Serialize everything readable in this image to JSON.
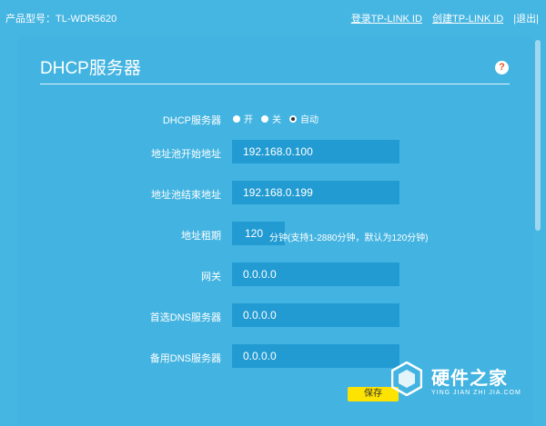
{
  "header": {
    "model": "产品型号：TL-WDR5620",
    "links": [
      "登录TP-LINK ID",
      "创建TP-LINK ID",
      "|退出|"
    ]
  },
  "page": {
    "title": "DHCP服务器",
    "help_icon": "?"
  },
  "form": {
    "dhcp": {
      "label": "DHCP服务器",
      "options": [
        "开",
        "关",
        "自动"
      ],
      "selected": "自动"
    },
    "start": {
      "label": "地址池开始地址",
      "value": "192.168.0.100"
    },
    "end": {
      "label": "地址池结束地址",
      "value": "192.168.0.199"
    },
    "lease": {
      "label": "地址租期",
      "value": "120",
      "hint": "分钟(支持1-2880分钟，默认为120分钟)"
    },
    "gateway": {
      "label": "网关",
      "value": "0.0.0.0"
    },
    "dns1": {
      "label": "首选DNS服务器",
      "value": "0.0.0.0"
    },
    "dns2": {
      "label": "备用DNS服务器",
      "value": "0.0.0.0"
    },
    "save_label": "保存"
  },
  "watermark": {
    "title": "硬件之家",
    "subtitle": "YING JIAN ZHI JIA.COM"
  },
  "colors": {
    "background": "#45b5e2",
    "field": "#229bd2",
    "save_button": "#fde301",
    "help_icon": "#e8561f"
  }
}
